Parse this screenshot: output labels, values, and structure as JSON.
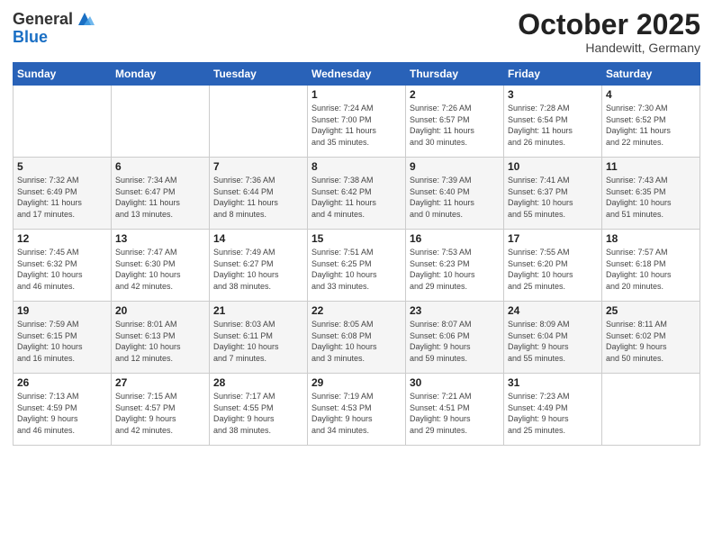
{
  "header": {
    "logo": {
      "general": "General",
      "blue": "Blue"
    },
    "month": "October 2025",
    "location": "Handewitt, Germany"
  },
  "days_of_week": [
    "Sunday",
    "Monday",
    "Tuesday",
    "Wednesday",
    "Thursday",
    "Friday",
    "Saturday"
  ],
  "weeks": [
    [
      {
        "day": "",
        "info": ""
      },
      {
        "day": "",
        "info": ""
      },
      {
        "day": "",
        "info": ""
      },
      {
        "day": "1",
        "info": "Sunrise: 7:24 AM\nSunset: 7:00 PM\nDaylight: 11 hours\nand 35 minutes."
      },
      {
        "day": "2",
        "info": "Sunrise: 7:26 AM\nSunset: 6:57 PM\nDaylight: 11 hours\nand 30 minutes."
      },
      {
        "day": "3",
        "info": "Sunrise: 7:28 AM\nSunset: 6:54 PM\nDaylight: 11 hours\nand 26 minutes."
      },
      {
        "day": "4",
        "info": "Sunrise: 7:30 AM\nSunset: 6:52 PM\nDaylight: 11 hours\nand 22 minutes."
      }
    ],
    [
      {
        "day": "5",
        "info": "Sunrise: 7:32 AM\nSunset: 6:49 PM\nDaylight: 11 hours\nand 17 minutes."
      },
      {
        "day": "6",
        "info": "Sunrise: 7:34 AM\nSunset: 6:47 PM\nDaylight: 11 hours\nand 13 minutes."
      },
      {
        "day": "7",
        "info": "Sunrise: 7:36 AM\nSunset: 6:44 PM\nDaylight: 11 hours\nand 8 minutes."
      },
      {
        "day": "8",
        "info": "Sunrise: 7:38 AM\nSunset: 6:42 PM\nDaylight: 11 hours\nand 4 minutes."
      },
      {
        "day": "9",
        "info": "Sunrise: 7:39 AM\nSunset: 6:40 PM\nDaylight: 11 hours\nand 0 minutes."
      },
      {
        "day": "10",
        "info": "Sunrise: 7:41 AM\nSunset: 6:37 PM\nDaylight: 10 hours\nand 55 minutes."
      },
      {
        "day": "11",
        "info": "Sunrise: 7:43 AM\nSunset: 6:35 PM\nDaylight: 10 hours\nand 51 minutes."
      }
    ],
    [
      {
        "day": "12",
        "info": "Sunrise: 7:45 AM\nSunset: 6:32 PM\nDaylight: 10 hours\nand 46 minutes."
      },
      {
        "day": "13",
        "info": "Sunrise: 7:47 AM\nSunset: 6:30 PM\nDaylight: 10 hours\nand 42 minutes."
      },
      {
        "day": "14",
        "info": "Sunrise: 7:49 AM\nSunset: 6:27 PM\nDaylight: 10 hours\nand 38 minutes."
      },
      {
        "day": "15",
        "info": "Sunrise: 7:51 AM\nSunset: 6:25 PM\nDaylight: 10 hours\nand 33 minutes."
      },
      {
        "day": "16",
        "info": "Sunrise: 7:53 AM\nSunset: 6:23 PM\nDaylight: 10 hours\nand 29 minutes."
      },
      {
        "day": "17",
        "info": "Sunrise: 7:55 AM\nSunset: 6:20 PM\nDaylight: 10 hours\nand 25 minutes."
      },
      {
        "day": "18",
        "info": "Sunrise: 7:57 AM\nSunset: 6:18 PM\nDaylight: 10 hours\nand 20 minutes."
      }
    ],
    [
      {
        "day": "19",
        "info": "Sunrise: 7:59 AM\nSunset: 6:15 PM\nDaylight: 10 hours\nand 16 minutes."
      },
      {
        "day": "20",
        "info": "Sunrise: 8:01 AM\nSunset: 6:13 PM\nDaylight: 10 hours\nand 12 minutes."
      },
      {
        "day": "21",
        "info": "Sunrise: 8:03 AM\nSunset: 6:11 PM\nDaylight: 10 hours\nand 7 minutes."
      },
      {
        "day": "22",
        "info": "Sunrise: 8:05 AM\nSunset: 6:08 PM\nDaylight: 10 hours\nand 3 minutes."
      },
      {
        "day": "23",
        "info": "Sunrise: 8:07 AM\nSunset: 6:06 PM\nDaylight: 9 hours\nand 59 minutes."
      },
      {
        "day": "24",
        "info": "Sunrise: 8:09 AM\nSunset: 6:04 PM\nDaylight: 9 hours\nand 55 minutes."
      },
      {
        "day": "25",
        "info": "Sunrise: 8:11 AM\nSunset: 6:02 PM\nDaylight: 9 hours\nand 50 minutes."
      }
    ],
    [
      {
        "day": "26",
        "info": "Sunrise: 7:13 AM\nSunset: 4:59 PM\nDaylight: 9 hours\nand 46 minutes."
      },
      {
        "day": "27",
        "info": "Sunrise: 7:15 AM\nSunset: 4:57 PM\nDaylight: 9 hours\nand 42 minutes."
      },
      {
        "day": "28",
        "info": "Sunrise: 7:17 AM\nSunset: 4:55 PM\nDaylight: 9 hours\nand 38 minutes."
      },
      {
        "day": "29",
        "info": "Sunrise: 7:19 AM\nSunset: 4:53 PM\nDaylight: 9 hours\nand 34 minutes."
      },
      {
        "day": "30",
        "info": "Sunrise: 7:21 AM\nSunset: 4:51 PM\nDaylight: 9 hours\nand 29 minutes."
      },
      {
        "day": "31",
        "info": "Sunrise: 7:23 AM\nSunset: 4:49 PM\nDaylight: 9 hours\nand 25 minutes."
      },
      {
        "day": "",
        "info": ""
      }
    ]
  ]
}
